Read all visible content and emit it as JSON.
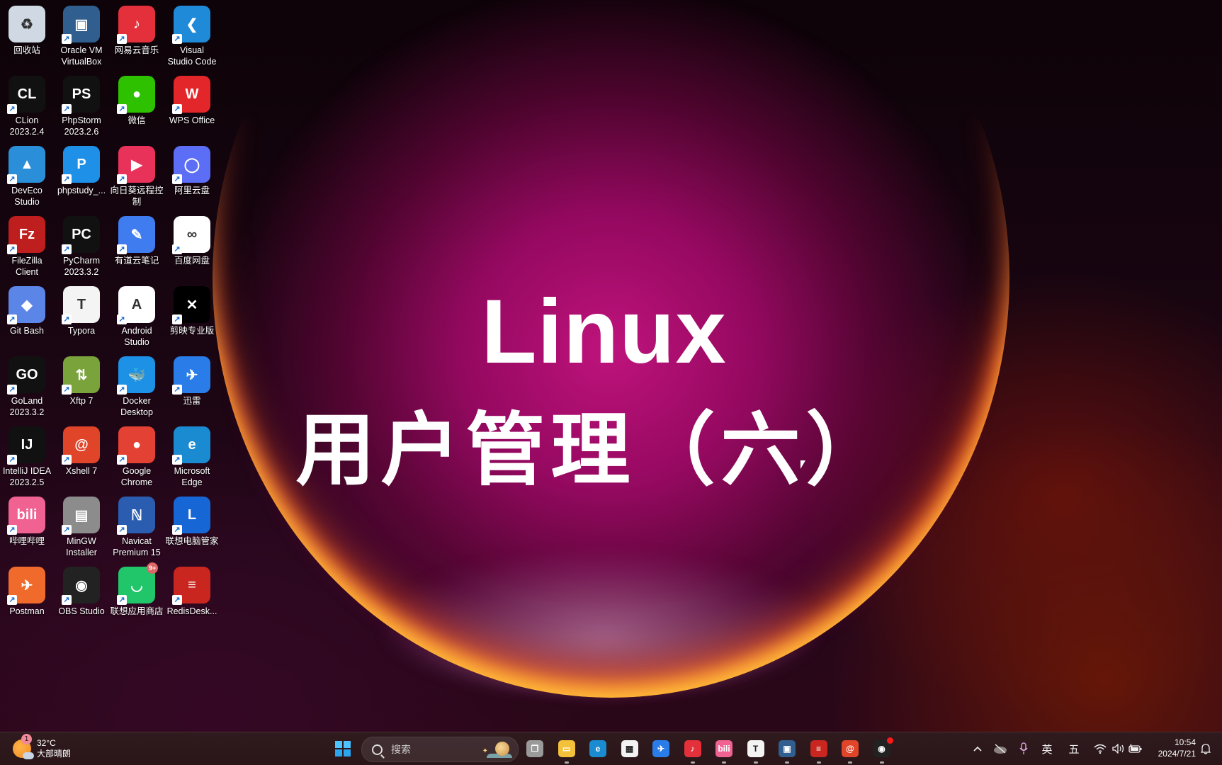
{
  "wallpaper": {
    "title_line1": "Linux",
    "title_line2": "用户管理（六）"
  },
  "desktop_icons": [
    {
      "label": "回收站",
      "icon": "recycle-bin-icon",
      "color": "#cfd8e3",
      "glyph": "♻",
      "shortcut": false
    },
    {
      "label": "Oracle VM\nVirtualBox",
      "icon": "virtualbox-icon",
      "color": "#2f5e8f",
      "glyph": "▣",
      "shortcut": true
    },
    {
      "label": "网易云音乐",
      "icon": "netease-music-icon",
      "color": "#e3303a",
      "glyph": "♪",
      "shortcut": true
    },
    {
      "label": "Visual\nStudio Code",
      "icon": "vscode-icon",
      "color": "#1f8ad8",
      "glyph": "❮",
      "shortcut": true
    },
    {
      "label": "CLion\n2023.2.4",
      "icon": "clion-icon",
      "color": "#111",
      "glyph": "CL",
      "shortcut": true
    },
    {
      "label": "PhpStorm\n2023.2.6",
      "icon": "phpstorm-icon",
      "color": "#111",
      "glyph": "PS",
      "shortcut": true
    },
    {
      "label": "微信",
      "icon": "wechat-icon",
      "color": "#2dc100",
      "glyph": "●",
      "shortcut": true
    },
    {
      "label": "WPS Office",
      "icon": "wps-office-icon",
      "color": "#e3262a",
      "glyph": "W",
      "shortcut": true
    },
    {
      "label": "DevEco\nStudio",
      "icon": "deveco-studio-icon",
      "color": "#2a8fd8",
      "glyph": "▲",
      "shortcut": true
    },
    {
      "label": "phpstudy_...",
      "icon": "phpstudy-icon",
      "color": "#1e90e8",
      "glyph": "P",
      "shortcut": true
    },
    {
      "label": "向日葵远程控\n制",
      "icon": "sunlogin-icon",
      "color": "#e8325a",
      "glyph": "▶",
      "shortcut": true
    },
    {
      "label": "阿里云盘",
      "icon": "aliyun-drive-icon",
      "color": "#5b6ef5",
      "glyph": "◯",
      "shortcut": true
    },
    {
      "label": "FileZilla\nClient",
      "icon": "filezilla-icon",
      "color": "#bf1e1e",
      "glyph": "Fz",
      "shortcut": true
    },
    {
      "label": "PyCharm\n2023.3.2",
      "icon": "pycharm-icon",
      "color": "#111",
      "glyph": "PC",
      "shortcut": true
    },
    {
      "label": "有道云笔记",
      "icon": "youdao-note-icon",
      "color": "#3f7cf0",
      "glyph": "✎",
      "shortcut": true
    },
    {
      "label": "百度网盘",
      "icon": "baidu-netdisk-icon",
      "color": "#ffffff",
      "glyph": "∞",
      "shortcut": true
    },
    {
      "label": "Git Bash",
      "icon": "git-bash-icon",
      "color": "#5c85e8",
      "glyph": "◆",
      "shortcut": true
    },
    {
      "label": "Typora",
      "icon": "typora-icon",
      "color": "#f4f4f4",
      "glyph": "T",
      "shortcut": true
    },
    {
      "label": "Android\nStudio",
      "icon": "android-studio-icon",
      "color": "#ffffff",
      "glyph": "A",
      "shortcut": true
    },
    {
      "label": "剪映专业版",
      "icon": "jianying-icon",
      "color": "#000000",
      "glyph": "✕",
      "shortcut": true
    },
    {
      "label": "GoLand\n2023.3.2",
      "icon": "goland-icon",
      "color": "#111",
      "glyph": "GO",
      "shortcut": true
    },
    {
      "label": "Xftp 7",
      "icon": "xftp-icon",
      "color": "#7aa33c",
      "glyph": "⇅",
      "shortcut": true
    },
    {
      "label": "Docker\nDesktop",
      "icon": "docker-icon",
      "color": "#1d91e6",
      "glyph": "🐳",
      "shortcut": true
    },
    {
      "label": "迅雷",
      "icon": "xunlei-icon",
      "color": "#2a7de8",
      "glyph": "✈",
      "shortcut": true
    },
    {
      "label": "IntelliJ IDEA\n2023.2.5",
      "icon": "intellij-idea-icon",
      "color": "#111",
      "glyph": "IJ",
      "shortcut": true
    },
    {
      "label": "Xshell 7",
      "icon": "xshell-icon",
      "color": "#e0452a",
      "glyph": "@",
      "shortcut": true
    },
    {
      "label": "Google\nChrome",
      "icon": "chrome-icon",
      "color": "#e34133",
      "glyph": "●",
      "shortcut": true
    },
    {
      "label": "Microsoft\nEdge",
      "icon": "edge-icon",
      "color": "#1a8ad1",
      "glyph": "e",
      "shortcut": true
    },
    {
      "label": "哔哩哔哩",
      "icon": "bilibili-icon",
      "color": "#f06292",
      "glyph": "bili",
      "shortcut": true
    },
    {
      "label": "MinGW\nInstaller",
      "icon": "mingw-installer-icon",
      "color": "#8c8c8c",
      "glyph": "▤",
      "shortcut": true
    },
    {
      "label": "Navicat\nPremium 15",
      "icon": "navicat-icon",
      "color": "#2a5db0",
      "glyph": "ℕ",
      "shortcut": true
    },
    {
      "label": "联想电脑管家",
      "icon": "lenovo-pc-manager-icon",
      "color": "#1766d6",
      "glyph": "L",
      "shortcut": true
    },
    {
      "label": "Postman",
      "icon": "postman-icon",
      "color": "#f06a2c",
      "glyph": "✈",
      "shortcut": true
    },
    {
      "label": "OBS Studio",
      "icon": "obs-studio-icon",
      "color": "#222",
      "glyph": "◉",
      "shortcut": true
    },
    {
      "label": "联想应用商店",
      "icon": "lenovo-app-store-icon",
      "color": "#21c56a",
      "glyph": "◡",
      "shortcut": true,
      "badge": "9+"
    },
    {
      "label": "RedisDesk...",
      "icon": "redis-desktop-icon",
      "color": "#c8261f",
      "glyph": "≡",
      "shortcut": true
    }
  ],
  "taskbar": {
    "weather": {
      "temp": "32°C",
      "desc": "大部晴朗",
      "badge": "1"
    },
    "search_placeholder": "搜索",
    "pinned": [
      {
        "name": "task-view",
        "icon": "task-view-icon",
        "color": "#9a9a9a",
        "glyph": "❐",
        "running": false
      },
      {
        "name": "file-explorer",
        "icon": "file-explorer-icon",
        "color": "#f3c13a",
        "glyph": "▭",
        "running": true
      },
      {
        "name": "edge",
        "icon": "edge-icon",
        "color": "#1a8ad1",
        "glyph": "e",
        "running": false
      },
      {
        "name": "microsoft-store",
        "icon": "microsoft-store-icon",
        "color": "#f2f2f2",
        "glyph": "▦",
        "running": false
      },
      {
        "name": "xunlei",
        "icon": "xunlei-icon",
        "color": "#2a7de8",
        "glyph": "✈",
        "running": false
      },
      {
        "name": "netease-music",
        "icon": "netease-music-icon",
        "color": "#e3303a",
        "glyph": "♪",
        "running": true
      },
      {
        "name": "bilibili",
        "icon": "bilibili-icon",
        "color": "#f06292",
        "glyph": "bili",
        "running": true
      },
      {
        "name": "typora",
        "icon": "typora-icon",
        "color": "#f4f4f4",
        "glyph": "T",
        "running": true
      },
      {
        "name": "virtualbox",
        "icon": "virtualbox-icon",
        "color": "#2f5e8f",
        "glyph": "▣",
        "running": true
      },
      {
        "name": "redis-desktop",
        "icon": "redis-desktop-icon",
        "color": "#c8261f",
        "glyph": "≡",
        "running": true
      },
      {
        "name": "xshell",
        "icon": "xshell-icon",
        "color": "#e0452a",
        "glyph": "@",
        "running": true
      },
      {
        "name": "obs-studio",
        "icon": "obs-studio-icon",
        "color": "#222",
        "glyph": "◉",
        "running": true,
        "recording": true
      }
    ],
    "tray": {
      "chevron": "^",
      "onedrive": "☁",
      "mic": "🎙",
      "ime_lang": "英",
      "ime_mode": "五",
      "wifi": "📶",
      "volume": "🔊",
      "battery": "🔋",
      "time": "10:54",
      "date": "2024/7/21",
      "notification": "🔔"
    }
  }
}
